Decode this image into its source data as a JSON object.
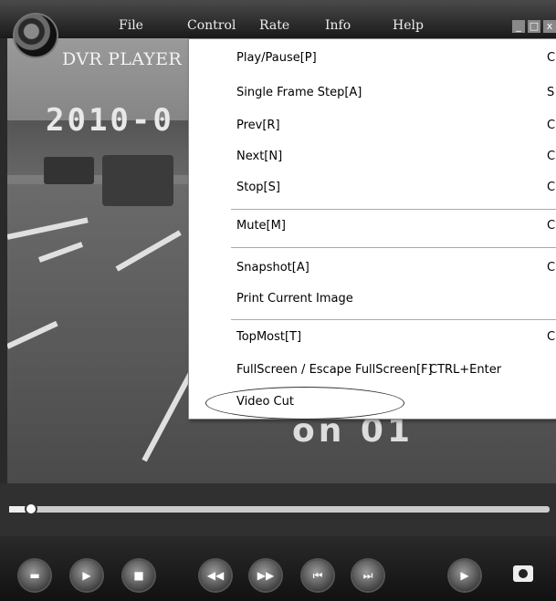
{
  "app": {
    "title": "DVR PLAYER"
  },
  "menubar": {
    "items": [
      "File",
      "Control",
      "Rate",
      "Info",
      "Help"
    ]
  },
  "window_buttons": [
    "_",
    "□",
    "x"
  ],
  "video": {
    "timestamp": "2010-0",
    "overlay_text": "on 01"
  },
  "control_menu": {
    "items": [
      {
        "label": "Play/Pause[P]",
        "shortcut": "C"
      },
      {
        "label": "Single Frame Step[A]",
        "shortcut": "S"
      },
      {
        "label": "Prev[R]",
        "shortcut": "C"
      },
      {
        "label": "Next[N]",
        "shortcut": "C"
      },
      {
        "label": "Stop[S]",
        "shortcut": "C"
      },
      {
        "label": "Mute[M]",
        "shortcut": "C"
      },
      {
        "label": "Snapshot[A]",
        "shortcut": "C"
      },
      {
        "label": "Print Current Image",
        "shortcut": ""
      },
      {
        "label": "TopMost[T]",
        "shortcut": "C"
      },
      {
        "label": "FullScreen / Escape FullScreen[F]",
        "shortcut": "CTRL+Enter"
      },
      {
        "label": "Video Cut",
        "shortcut": ""
      }
    ]
  },
  "seek": {
    "position_fraction": 0.04
  },
  "controls": {
    "buttons": [
      "open-icon",
      "play-icon",
      "stop-icon",
      "rewind-icon",
      "fast-forward-icon",
      "prev-icon",
      "next-icon",
      "play-icon",
      "camera-icon"
    ]
  }
}
